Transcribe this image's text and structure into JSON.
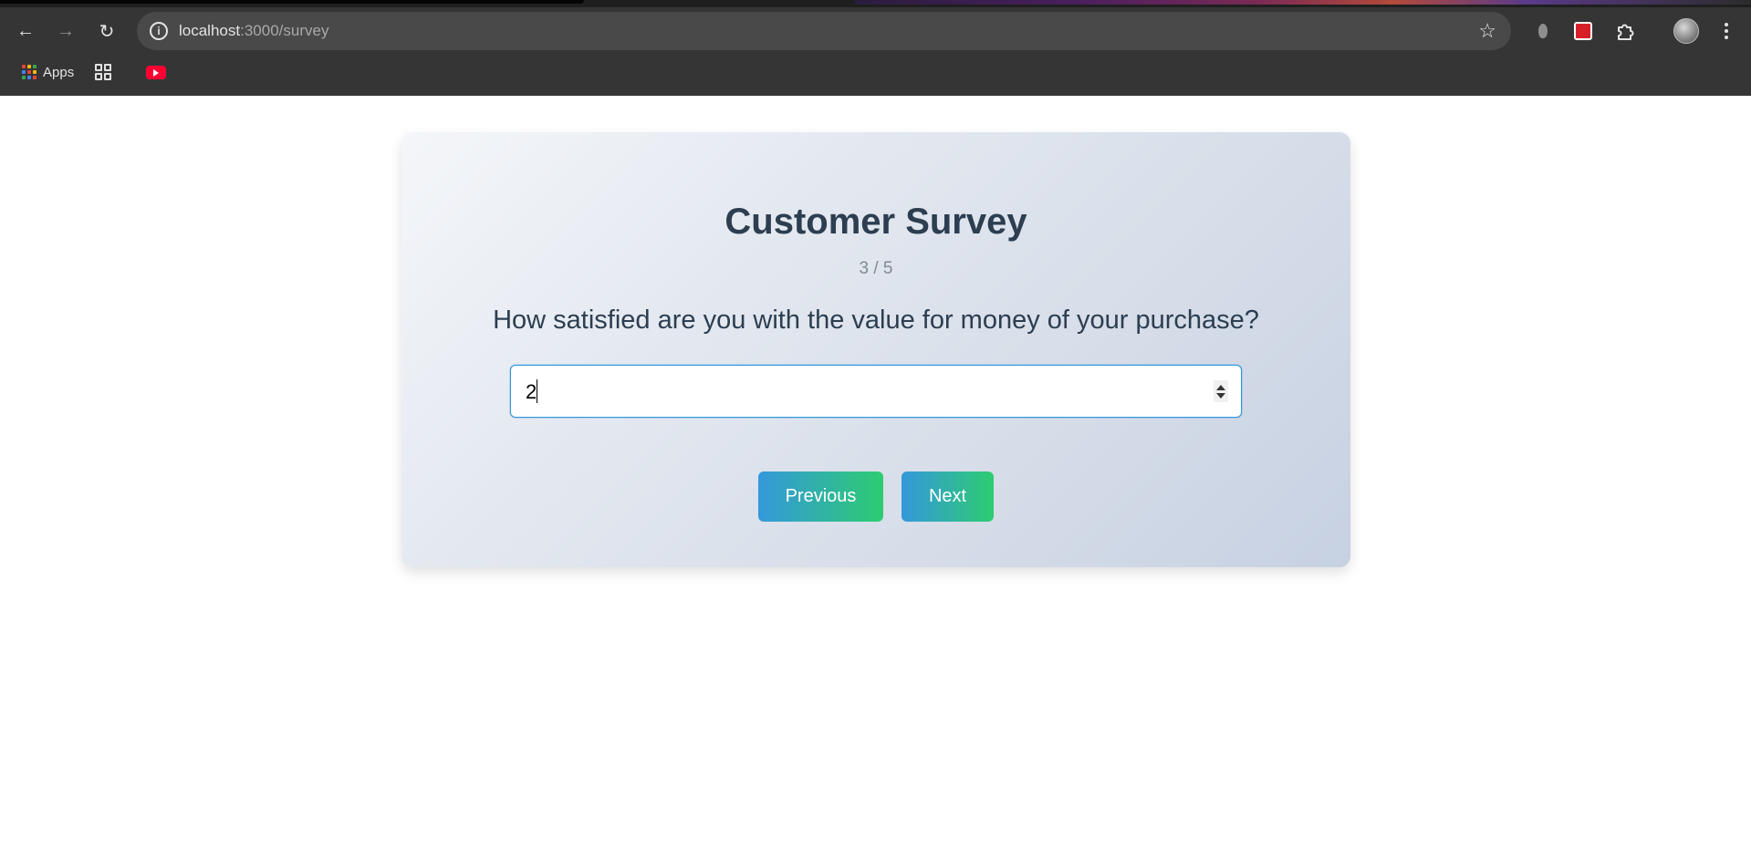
{
  "browser": {
    "url_host": "localhost",
    "url_path": ":3000/survey",
    "bookmarks": {
      "apps_label": "Apps"
    },
    "apps_colors": [
      "#ea4335",
      "#fbbc05",
      "#34a853",
      "#4285f4",
      "#ea4335",
      "#fbbc05",
      "#34a853",
      "#4285f4",
      "#ea4335"
    ]
  },
  "survey": {
    "title": "Customer Survey",
    "progress": "3 / 5",
    "question": "How satisfied are you with the value for money of your purchase?",
    "answer_value": "2",
    "previous_label": "Previous",
    "next_label": "Next"
  },
  "colors": {
    "accent_start": "#3498db",
    "accent_end": "#2ecc71",
    "title": "#2c3e50"
  }
}
